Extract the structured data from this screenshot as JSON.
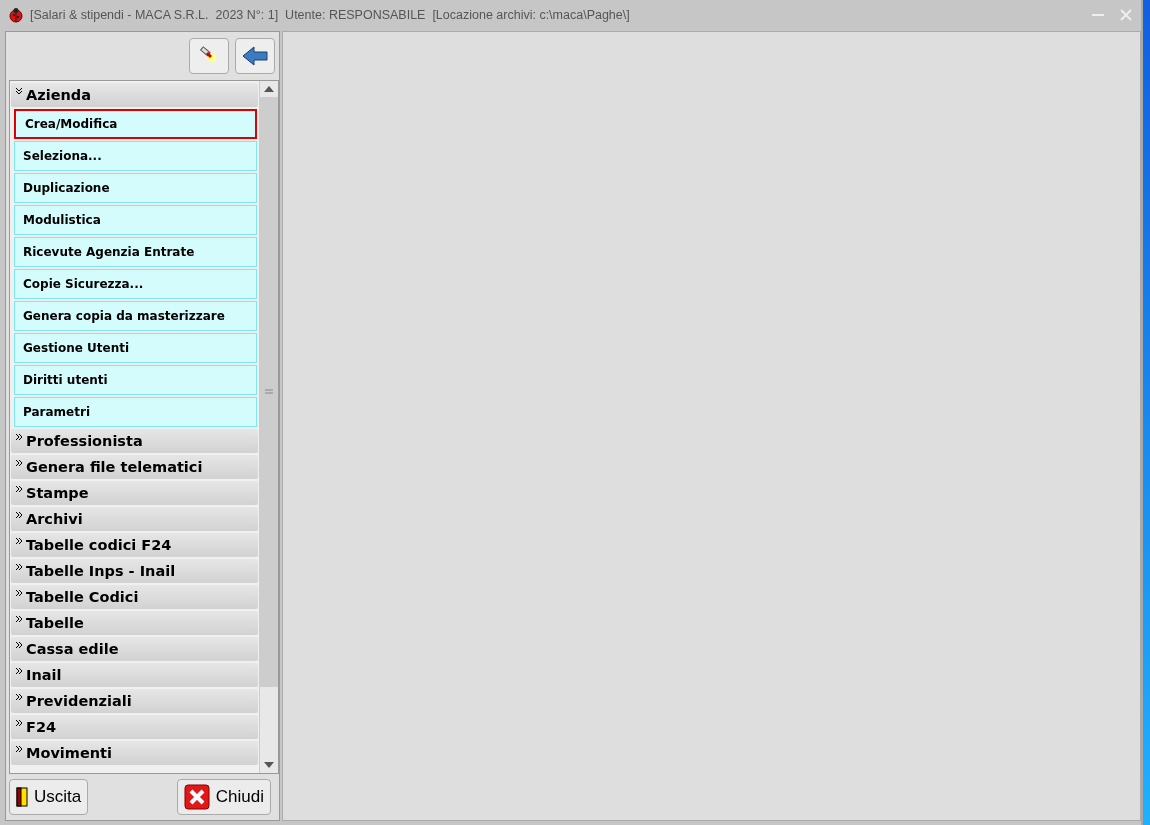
{
  "window": {
    "title": "[Salari & stipendi - MACA S.R.L.  2023 N°: 1]  Utente: RESPONSABILE  [Locazione archivi: c:\\maca\\Paghe\\]"
  },
  "menu": [
    {
      "label": "Azienda",
      "expanded": true,
      "items": [
        {
          "label": "Crea/Modifica",
          "selected": true
        },
        {
          "label": "Seleziona...",
          "selected": false
        },
        {
          "label": "Duplicazione",
          "selected": false
        },
        {
          "label": "Modulistica",
          "selected": false
        },
        {
          "label": "Ricevute Agenzia Entrate",
          "selected": false
        },
        {
          "label": "Copie Sicurezza...",
          "selected": false
        },
        {
          "label": "Genera copia da masterizzare",
          "selected": false
        },
        {
          "label": "Gestione Utenti",
          "selected": false
        },
        {
          "label": "Diritti utenti",
          "selected": false
        },
        {
          "label": "Parametri",
          "selected": false
        }
      ]
    },
    {
      "label": "Professionista",
      "expanded": false
    },
    {
      "label": "Genera file telematici",
      "expanded": false
    },
    {
      "label": "Stampe",
      "expanded": false
    },
    {
      "label": "Archivi",
      "expanded": false
    },
    {
      "label": "Tabelle codici F24",
      "expanded": false
    },
    {
      "label": "Tabelle Inps - Inail",
      "expanded": false
    },
    {
      "label": "Tabelle Codici",
      "expanded": false
    },
    {
      "label": "Tabelle",
      "expanded": false
    },
    {
      "label": "Cassa edile",
      "expanded": false
    },
    {
      "label": "Inail",
      "expanded": false
    },
    {
      "label": "Previdenziali",
      "expanded": false
    },
    {
      "label": "F24",
      "expanded": false
    },
    {
      "label": "Movimenti",
      "expanded": false
    }
  ],
  "footer_buttons": [
    {
      "kind": "exit",
      "label": "Uscita"
    },
    {
      "kind": "close",
      "label": "Chiudi"
    }
  ]
}
